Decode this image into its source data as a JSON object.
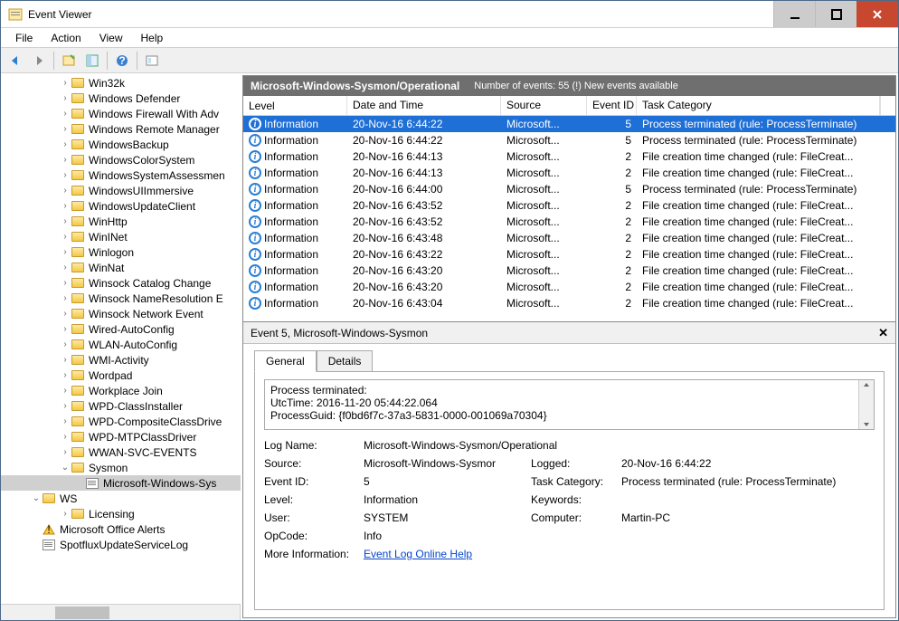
{
  "window": {
    "title": "Event Viewer"
  },
  "menu": {
    "file": "File",
    "action": "Action",
    "view": "View",
    "help": "Help"
  },
  "tree": {
    "folders": [
      "Win32k",
      "Windows Defender",
      "Windows Firewall With Adv",
      "Windows Remote Manager",
      "WindowsBackup",
      "WindowsColorSystem",
      "WindowsSystemAssessmen",
      "WindowsUIImmersive",
      "WindowsUpdateClient",
      "WinHttp",
      "WinINet",
      "Winlogon",
      "WinNat",
      "Winsock Catalog Change",
      "Winsock NameResolution E",
      "Winsock Network Event",
      "Wired-AutoConfig",
      "WLAN-AutoConfig",
      "WMI-Activity",
      "Wordpad",
      "Workplace Join",
      "WPD-ClassInstaller",
      "WPD-CompositeClassDrive",
      "WPD-MTPClassDriver",
      "WWAN-SVC-EVENTS"
    ],
    "sysmon": "Sysmon",
    "sysmon_child": "Microsoft-Windows-Sys",
    "ws": "WS",
    "licensing": "Licensing",
    "office": "Microsoft Office Alerts",
    "spotflux": "SpotfluxUpdateServiceLog"
  },
  "pane": {
    "title": "Microsoft-Windows-Sysmon/Operational",
    "subtitle": "Number of events: 55 (!) New events available"
  },
  "cols": {
    "level": "Level",
    "date": "Date and Time",
    "source": "Source",
    "eid": "Event ID",
    "task": "Task Category"
  },
  "rows": [
    {
      "level": "Information",
      "date": "20-Nov-16 6:44:22",
      "src": "Microsoft...",
      "eid": "5",
      "task": "Process terminated (rule: ProcessTerminate)"
    },
    {
      "level": "Information",
      "date": "20-Nov-16 6:44:22",
      "src": "Microsoft...",
      "eid": "5",
      "task": "Process terminated (rule: ProcessTerminate)"
    },
    {
      "level": "Information",
      "date": "20-Nov-16 6:44:13",
      "src": "Microsoft...",
      "eid": "2",
      "task": "File creation time changed (rule: FileCreat..."
    },
    {
      "level": "Information",
      "date": "20-Nov-16 6:44:13",
      "src": "Microsoft...",
      "eid": "2",
      "task": "File creation time changed (rule: FileCreat..."
    },
    {
      "level": "Information",
      "date": "20-Nov-16 6:44:00",
      "src": "Microsoft...",
      "eid": "5",
      "task": "Process terminated (rule: ProcessTerminate)"
    },
    {
      "level": "Information",
      "date": "20-Nov-16 6:43:52",
      "src": "Microsoft...",
      "eid": "2",
      "task": "File creation time changed (rule: FileCreat..."
    },
    {
      "level": "Information",
      "date": "20-Nov-16 6:43:52",
      "src": "Microsoft...",
      "eid": "2",
      "task": "File creation time changed (rule: FileCreat..."
    },
    {
      "level": "Information",
      "date": "20-Nov-16 6:43:48",
      "src": "Microsoft...",
      "eid": "2",
      "task": "File creation time changed (rule: FileCreat..."
    },
    {
      "level": "Information",
      "date": "20-Nov-16 6:43:22",
      "src": "Microsoft...",
      "eid": "2",
      "task": "File creation time changed (rule: FileCreat..."
    },
    {
      "level": "Information",
      "date": "20-Nov-16 6:43:20",
      "src": "Microsoft...",
      "eid": "2",
      "task": "File creation time changed (rule: FileCreat..."
    },
    {
      "level": "Information",
      "date": "20-Nov-16 6:43:20",
      "src": "Microsoft...",
      "eid": "2",
      "task": "File creation time changed (rule: FileCreat..."
    },
    {
      "level": "Information",
      "date": "20-Nov-16 6:43:04",
      "src": "Microsoft...",
      "eid": "2",
      "task": "File creation time changed (rule: FileCreat..."
    }
  ],
  "detail": {
    "title": "Event 5, Microsoft-Windows-Sysmon",
    "tabs": {
      "general": "General",
      "details": "Details"
    },
    "msg1": "Process terminated:",
    "msg2": "UtcTime: 2016-11-20 05:44:22.064",
    "msg3": "ProcessGuid: {f0bd6f7c-37a3-5831-0000-001069a70304}",
    "labels": {
      "logname": "Log Name:",
      "source": "Source:",
      "eventid": "Event ID:",
      "level": "Level:",
      "user": "User:",
      "opcode": "OpCode:",
      "moreinfo": "More Information:",
      "logged": "Logged:",
      "taskcat": "Task Category:",
      "keywords": "Keywords:",
      "computer": "Computer:"
    },
    "vals": {
      "logname": "Microsoft-Windows-Sysmon/Operational",
      "source": "Microsoft-Windows-Sysmor",
      "eventid": "5",
      "level": "Information",
      "user": "SYSTEM",
      "opcode": "Info",
      "logged": "20-Nov-16 6:44:22",
      "taskcat": "Process terminated (rule: ProcessTerminate)",
      "keywords": "",
      "computer": "Martin-PC",
      "link": "Event Log Online Help"
    }
  }
}
